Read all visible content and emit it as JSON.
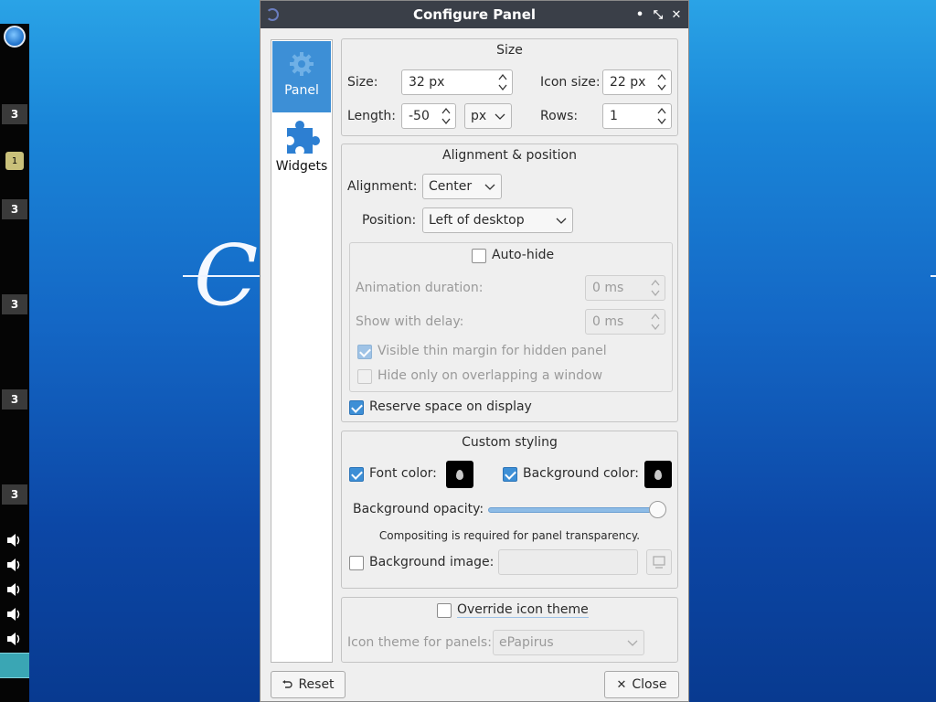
{
  "desktop": {
    "text": "Co"
  },
  "side_panel": {
    "desktop_buttons": [
      "3",
      "3",
      "3",
      "3",
      "3"
    ],
    "tray_app_badge": "1",
    "volume_icons": 5
  },
  "window": {
    "title": "Configure Panel",
    "buttons": {
      "minimize": "•",
      "maximize": "⤡",
      "close": "✕"
    }
  },
  "pages": [
    {
      "label": "Panel",
      "icon": "gear-icon",
      "active": true
    },
    {
      "label": "Widgets",
      "icon": "puzzle-icon",
      "active": false
    }
  ],
  "size": {
    "title": "Size",
    "size_label": "Size:",
    "size_value": "32 px",
    "icon_size_label": "Icon size:",
    "icon_size_value": "22 px",
    "length_label": "Length:",
    "length_value": "-50",
    "length_unit": "px",
    "rows_label": "Rows:",
    "rows_value": "1"
  },
  "alignment": {
    "title": "Alignment & position",
    "alignment_label": "Alignment:",
    "alignment_value": "Center",
    "position_label": "Position:",
    "position_value": "Left of desktop",
    "autohide_label": "Auto-hide",
    "autohide_checked": false,
    "animation_label": "Animation duration:",
    "animation_value": "0 ms",
    "delay_label": "Show with delay:",
    "delay_value": "0 ms",
    "thin_margin_label": "Visible thin margin for hidden panel",
    "thin_margin_checked": true,
    "overlap_label": "Hide only on overlapping a window",
    "overlap_checked": false,
    "reserve_label": "Reserve space on display",
    "reserve_checked": true
  },
  "styling": {
    "title": "Custom styling",
    "font_color_label": "Font color:",
    "font_color_checked": true,
    "font_color": "#000000",
    "bg_color_label": "Background color:",
    "bg_color_checked": true,
    "bg_color": "#000000",
    "opacity_label": "Background opacity:",
    "opacity_value": 1.0,
    "note": "Compositing is required for panel transparency.",
    "bg_image_label": "Background image:",
    "bg_image_checked": false
  },
  "icon_theme": {
    "override_label": "Override icon theme",
    "override_checked": false,
    "theme_label": "Icon theme for panels:",
    "theme_value": "ePapirus"
  },
  "footer": {
    "reset_label": "Reset",
    "close_label": "Close"
  }
}
